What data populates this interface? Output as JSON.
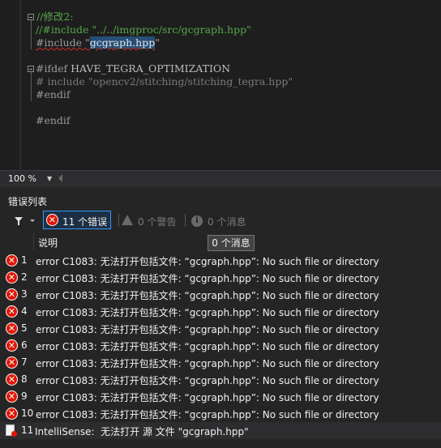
{
  "editor": {
    "lines": [
      {
        "text": "//修改2:"
      },
      {
        "text": "//#include \"../../imgproc/src/gcgraph.hpp\""
      },
      {
        "pre": "#include \"",
        "selected": "gcgraph.hpp",
        "post": "\""
      },
      {
        "directive": "#ifdef",
        "macro": "HAVE_TEGRA_OPTIMIZATION"
      },
      {
        "text": "# include \"opencv2/stitching/stitching_tegra.hpp\""
      },
      {
        "text": "#endif"
      },
      {
        "text": "#endif"
      }
    ]
  },
  "statusbar": {
    "zoom": "100 %"
  },
  "error_list": {
    "title": "错误列表",
    "errors_label": "11 个错误",
    "warnings_label": "0 个警告",
    "messages_label": "0 个消息",
    "tooltip": "0 个消息",
    "column_description": "说明",
    "rows": [
      {
        "num": "1",
        "text": "error C1083: 无法打开包括文件: “gcgraph.hpp”: No such file or directory"
      },
      {
        "num": "2",
        "text": "error C1083: 无法打开包括文件: “gcgraph.hpp”: No such file or directory"
      },
      {
        "num": "3",
        "text": "error C1083: 无法打开包括文件: “gcgraph.hpp”: No such file or directory"
      },
      {
        "num": "4",
        "text": "error C1083: 无法打开包括文件: “gcgraph.hpp”: No such file or directory"
      },
      {
        "num": "5",
        "text": "error C1083: 无法打开包括文件: “gcgraph.hpp”: No such file or directory"
      },
      {
        "num": "6",
        "text": "error C1083: 无法打开包括文件: “gcgraph.hpp”: No such file or directory"
      },
      {
        "num": "7",
        "text": "error C1083: 无法打开包括文件: “gcgraph.hpp”: No such file or directory"
      },
      {
        "num": "8",
        "text": "error C1083: 无法打开包括文件: “gcgraph.hpp”: No such file or directory"
      },
      {
        "num": "9",
        "text": "error C1083: 无法打开包括文件: “gcgraph.hpp”: No such file or directory"
      },
      {
        "num": "10",
        "text": "error C1083: 无法打开包括文件: “gcgraph.hpp”: No such file or directory"
      },
      {
        "num": "11",
        "text": "IntelliSense:  无法打开 源 文件 \"gcgraph.hpp\""
      }
    ]
  },
  "colors": {
    "error": "#e51400",
    "selection": "#264f78",
    "comment": "#57a64a",
    "accent": "#3399ff"
  },
  "icons": {
    "error": "error-x-icon",
    "warning": "warning-icon",
    "info": "info-icon",
    "filter": "filter-icon",
    "file_error": "file-error-icon"
  }
}
